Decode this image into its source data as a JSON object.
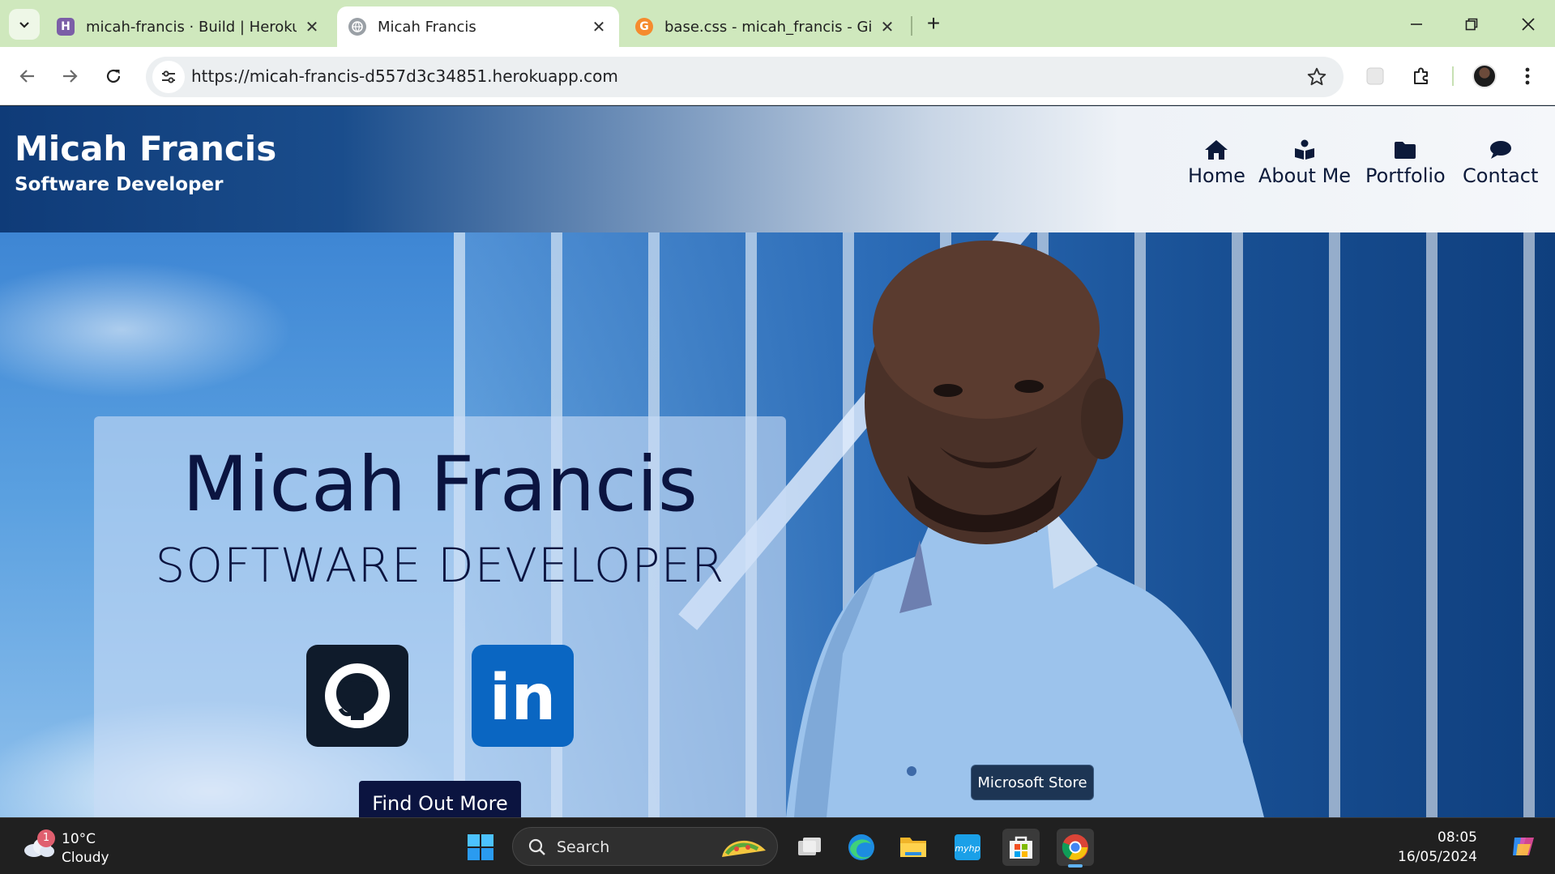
{
  "browser": {
    "tabs": [
      {
        "title": "micah-francis · Build | Heroku",
        "favicon": "heroku-icon",
        "active": false
      },
      {
        "title": "Micah Francis",
        "favicon": "globe-icon",
        "active": true
      },
      {
        "title": "base.css - micah_francis - Gitpo",
        "favicon": "gitpod-icon",
        "active": false
      }
    ],
    "url": "https://micah-francis-d557d3c34851.herokuapp.com"
  },
  "site": {
    "brand_name": "Micah Francis",
    "brand_tagline": "Software Developer",
    "nav": [
      {
        "label": "Home",
        "icon": "home-icon"
      },
      {
        "label": "About Me",
        "icon": "reader-icon"
      },
      {
        "label": "Portfolio",
        "icon": "folder-icon"
      },
      {
        "label": "Contact",
        "icon": "chat-icon"
      }
    ],
    "hero": {
      "name": "Micah Francis",
      "role": "SOFTWARE DEVELOPER",
      "linkedin_text": "in",
      "cta_label": "Find Out More"
    }
  },
  "tooltip": "Microsoft Store",
  "taskbar": {
    "weather_badge": "1",
    "temperature": "10°C",
    "condition": "Cloudy",
    "search_placeholder": "Search",
    "time": "08:05",
    "date": "16/05/2024"
  },
  "colors": {
    "tabstrip": "#cfe8bd",
    "brand_text": "#ffffff",
    "hero_text": "#0b1440",
    "linkedin": "#0a66c2",
    "github": "#0f1b2b"
  }
}
